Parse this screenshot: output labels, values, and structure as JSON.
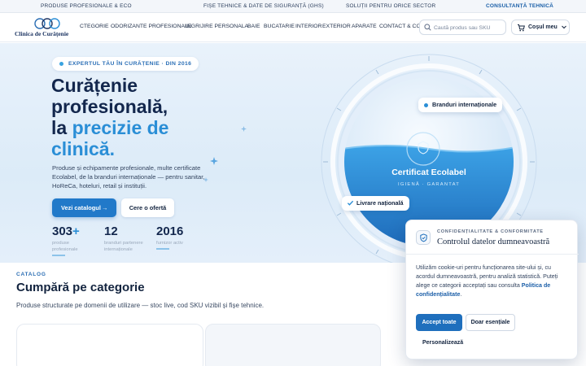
{
  "topbar": {
    "items": [
      "PRODUSE PROFESIONALE & ECO",
      "FIȘE TEHNICE & DATE DE SIGURANȚĂ (GHS)",
      "SOLUȚII PENTRU ORICE SECTOR",
      "CONSULTANȚĂ TEHNICĂ"
    ]
  },
  "header": {
    "logo_text": "Clinica de Curățenie",
    "nav": [
      "CTEGORIE",
      "ODORIZANTE PROFESIONALE",
      "INGRIJIRE PERSONALA",
      "BAIE",
      "BUCATARIE",
      "INTERIOR",
      "EXTERIOR",
      "APARATE",
      "CONTACT & CO"
    ],
    "search_placeholder": "Caută produs sau SKU",
    "cart_label": "Coșul meu"
  },
  "hero": {
    "badge": "EXPERTUL TĂU ÎN CURĂȚENIE · DIN 2016",
    "title_line1": "Curățenie",
    "title_line2": "profesională,",
    "title_line3_plain": "la ",
    "title_line3_accent": "precizie de",
    "title_line4_accent": "clinică.",
    "description": "Produse și echipamente profesionale, multe certificate Ecolabel, de la branduri internaționale — pentru sanitar, HoReCa, hoteluri, retail și instituții.",
    "primary_button": "Vezi catalogul",
    "secondary_button": "Cere o ofertă",
    "stats": [
      {
        "value": "303",
        "suffix": "+",
        "label": "produse profesionale"
      },
      {
        "value": "12",
        "suffix": "",
        "label": "branduri partenere internaționale"
      },
      {
        "value": "2016",
        "suffix": "",
        "label": "furnizor activ"
      }
    ],
    "graphic": {
      "pill_international": "Branduri internaționale",
      "pill_shipping": "Livrare națională",
      "cert_title": "Certificat Ecolabel",
      "cert_subtitle": "IGIENĂ · GARANTAT"
    }
  },
  "catalog": {
    "eyebrow": "CATALOG",
    "title": "Cumpără pe categorie",
    "description": "Produse structurate pe domenii de utilizare — stoc live, cod SKU vizibil și fișe tehnice."
  },
  "cookie": {
    "eyebrow": "CONFIDENȚIALITATE & CONFORMITATE",
    "title": "Controlul datelor dumneavoastră",
    "body": "Utilizăm cookie-uri pentru funcționarea site-ului și, cu acordul dumneavoastră, pentru analiză statistică. Puteți alege ce categorii acceptați sau consulta ",
    "link": "Politica de confidențialitate",
    "body_end": ".",
    "accept_all": "Accept toate",
    "only_essential": "Doar esențiale",
    "customize": "Personalizează"
  },
  "colors": {
    "brand": "#1f6fbd",
    "accent": "#2a8ed6",
    "dark": "#13243f"
  }
}
